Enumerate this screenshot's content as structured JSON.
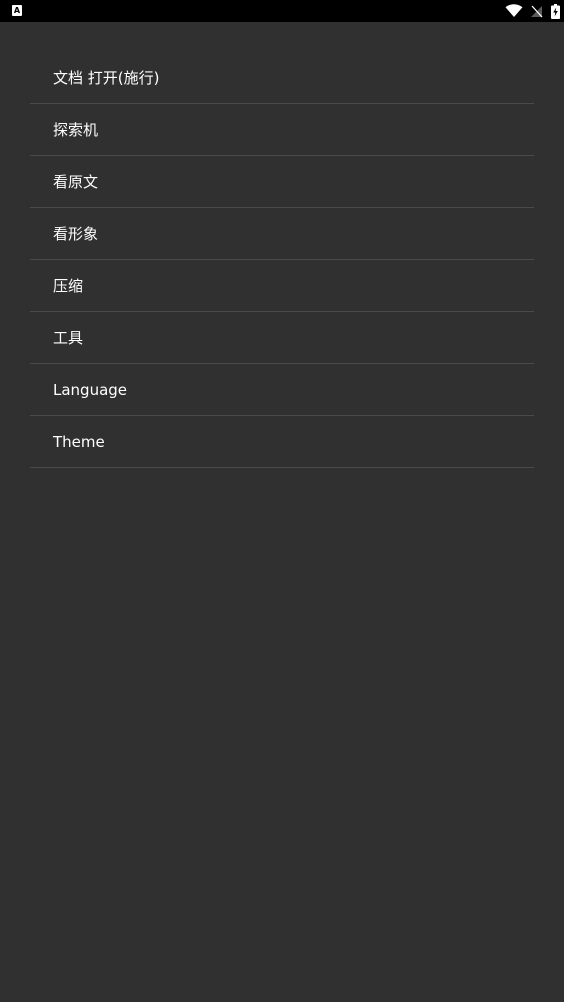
{
  "status_bar": {
    "left_icon": "A",
    "icons": [
      "wifi-icon",
      "signal-off-icon",
      "battery-charging-icon"
    ]
  },
  "menu": {
    "items": [
      {
        "label": "文档 打开(施行)"
      },
      {
        "label": "探索机"
      },
      {
        "label": "看原文"
      },
      {
        "label": "看形象"
      },
      {
        "label": "压缩"
      },
      {
        "label": "工具"
      },
      {
        "label": "Language"
      },
      {
        "label": "Theme"
      }
    ]
  },
  "colors": {
    "background": "#303030",
    "status_bar": "#000000",
    "divider": "#4a4a4a",
    "text": "#ffffff"
  }
}
